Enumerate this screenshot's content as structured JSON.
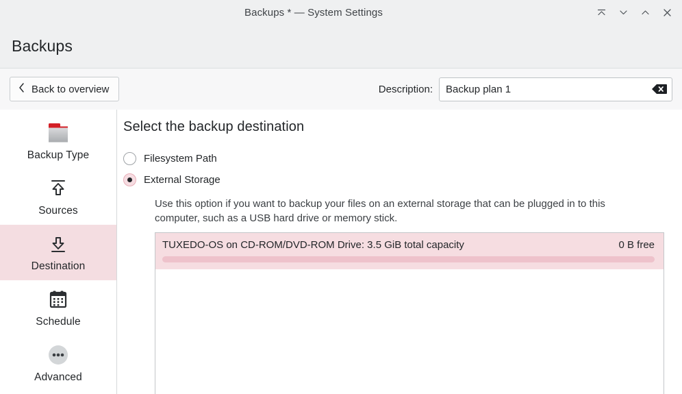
{
  "window": {
    "title": "Backups * — System Settings",
    "controls": [
      {
        "name": "keep-above-icon",
        "label": "Keep above"
      },
      {
        "name": "minimize-icon",
        "label": "Minimize"
      },
      {
        "name": "maximize-icon",
        "label": "Maximize"
      },
      {
        "name": "close-icon",
        "label": "Close"
      }
    ]
  },
  "header": {
    "title": "Backups"
  },
  "toolbar": {
    "back_label": "Back to overview",
    "description_label": "Description:",
    "description_value": "Backup plan 1",
    "description_placeholder": "",
    "clear_icon": "clear-text-icon"
  },
  "sidebar": {
    "items": [
      {
        "label": "Backup Type",
        "icon": "folder-icon",
        "selected": false
      },
      {
        "label": "Sources",
        "icon": "upload-arrow-icon",
        "selected": false
      },
      {
        "label": "Destination",
        "icon": "download-arrow-icon",
        "selected": true
      },
      {
        "label": "Schedule",
        "icon": "calendar-icon",
        "selected": false
      },
      {
        "label": "Advanced",
        "icon": "ellipsis-circle-icon",
        "selected": false
      }
    ]
  },
  "main": {
    "heading": "Select the backup destination",
    "options": [
      {
        "label": "Filesystem Path",
        "selected": false
      },
      {
        "label": "External Storage",
        "selected": true
      }
    ],
    "option_description": "Use this option if you want to backup your files on an external storage that can be plugged in to this computer, such as a USB hard drive or memory stick.",
    "storage_devices": [
      {
        "name": "TUXEDO-OS on CD-ROM/DVD-ROM Drive: 3.5 GiB total capacity",
        "free": "0 B free",
        "used_percent": 100,
        "selected": true
      }
    ]
  },
  "colors": {
    "accent_selection": "#f4dde1",
    "titlebar_bg": "#eff0f1",
    "toolbar_bg": "#f7f7f8",
    "text": "#232629",
    "folder_tab_red": "#d31f26"
  }
}
